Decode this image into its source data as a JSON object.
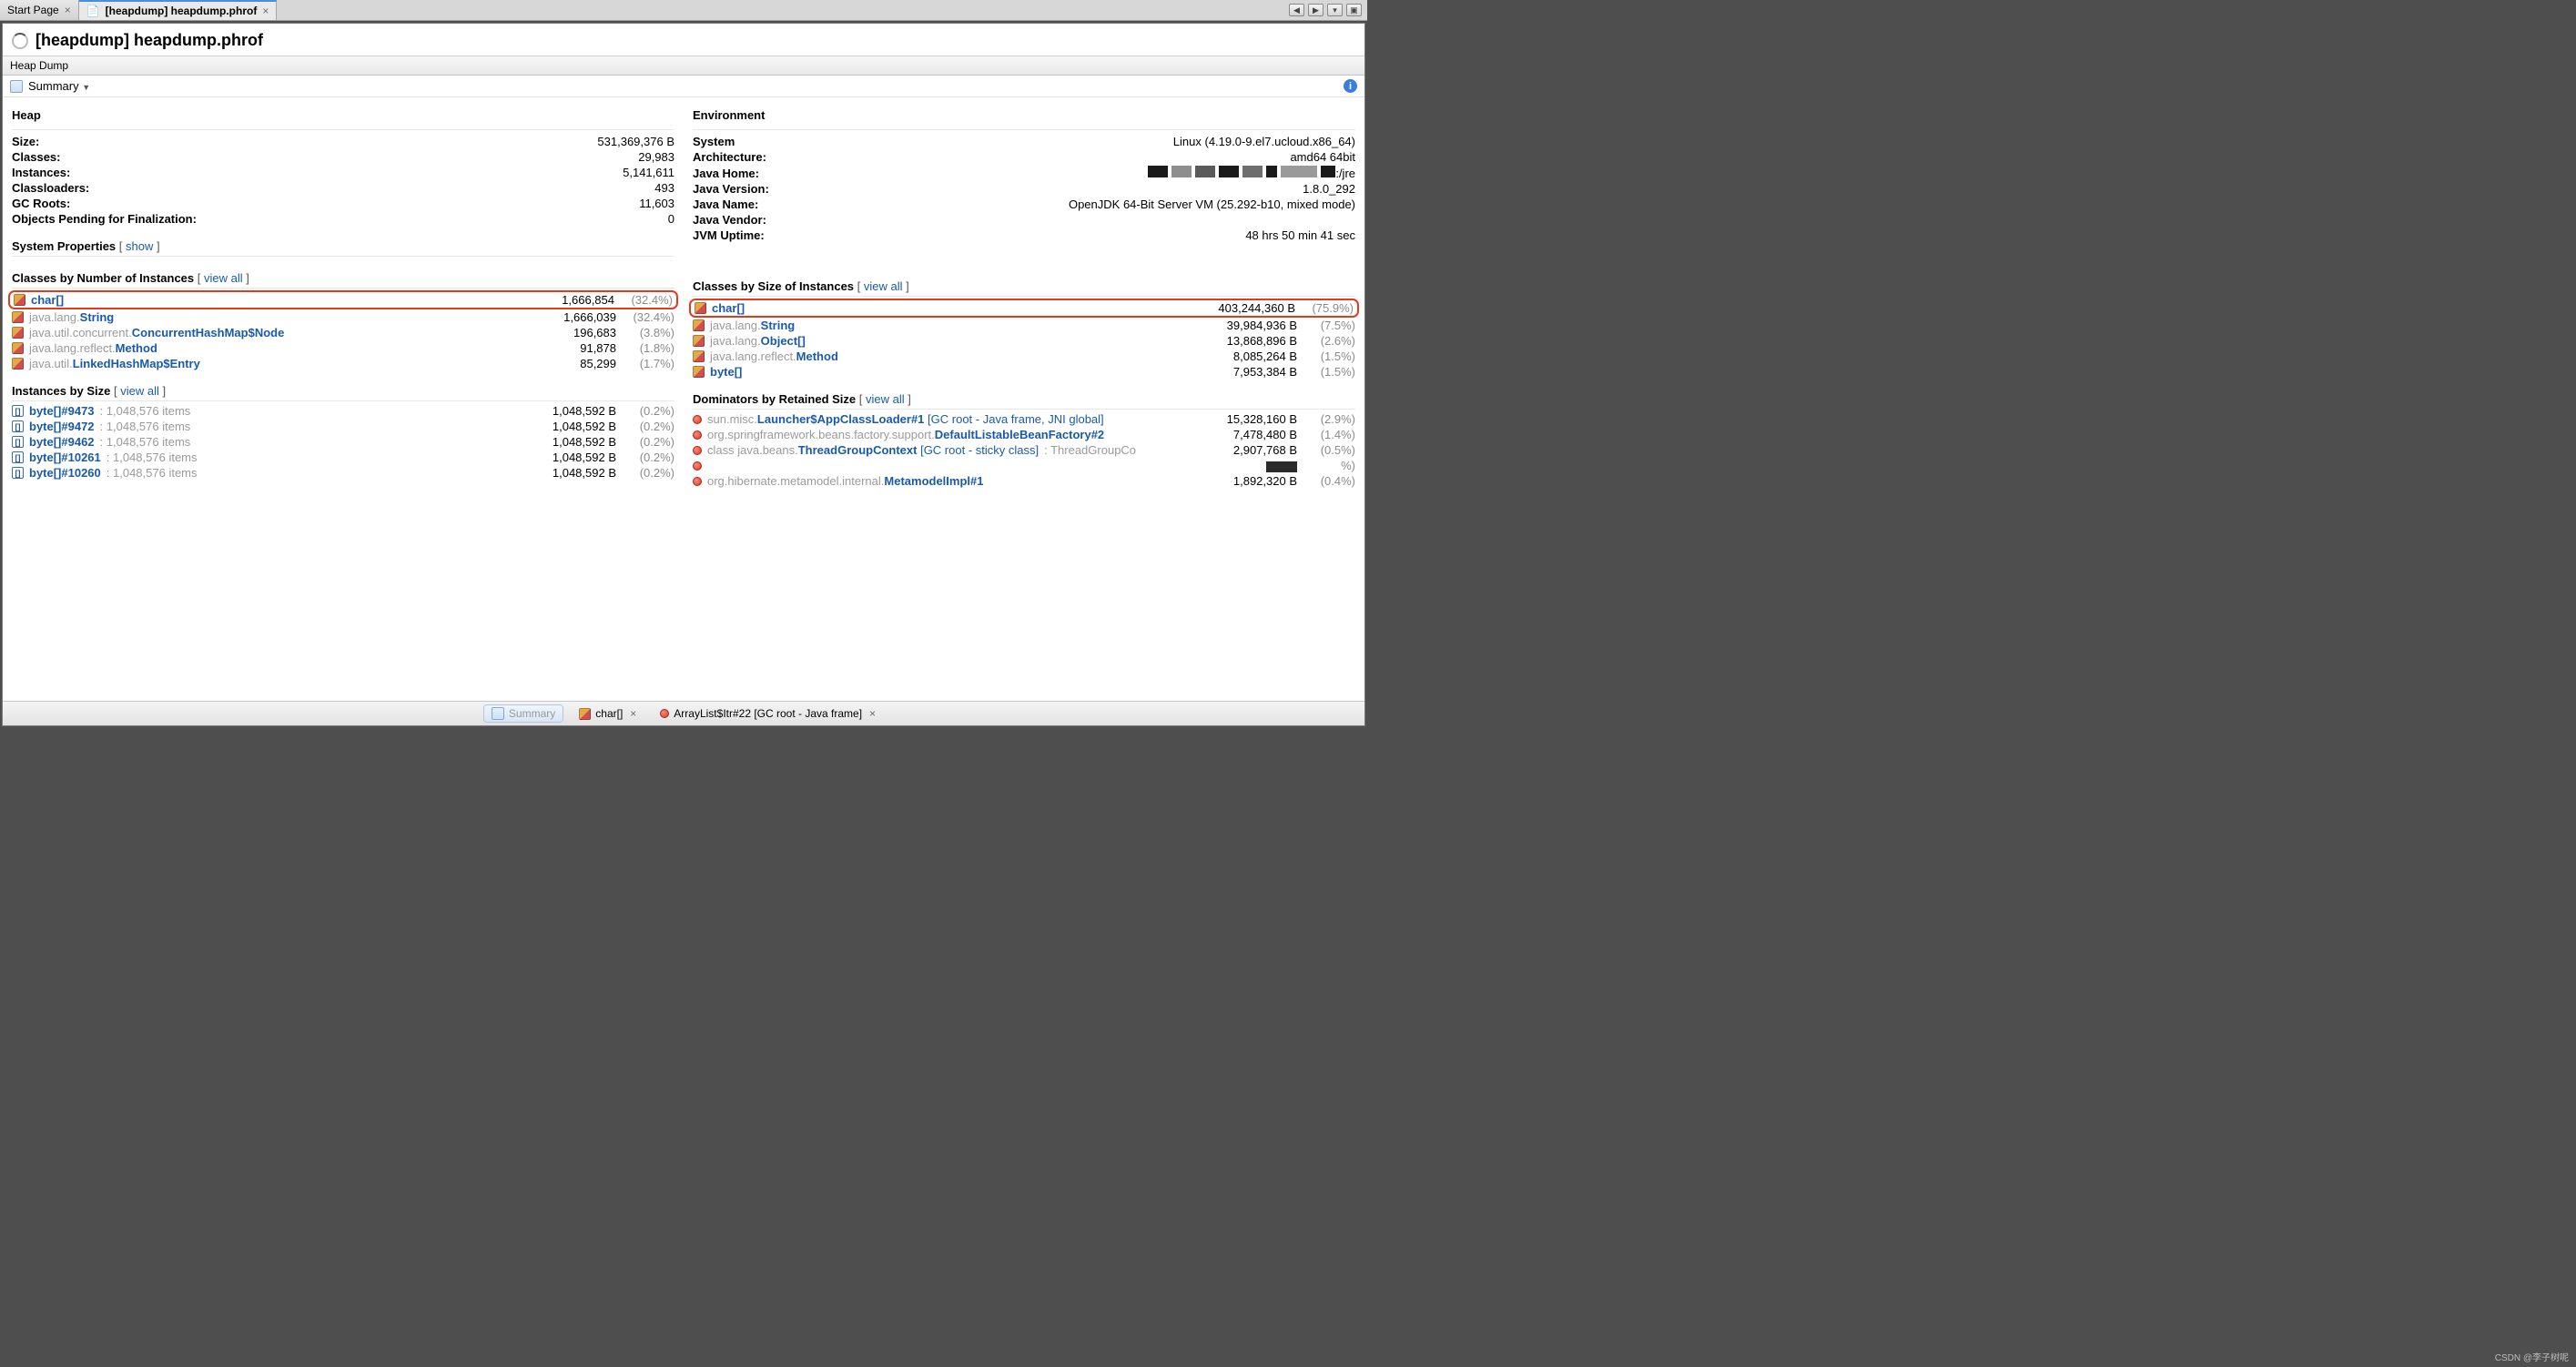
{
  "tabs": {
    "start": "Start Page",
    "heapdump": "[heapdump] heapdump.phrof"
  },
  "title": "[heapdump] heapdump.phrof",
  "subTab": "Heap Dump",
  "toolbar": {
    "summary": "Summary"
  },
  "heap": {
    "heading": "Heap",
    "rows": [
      {
        "label": "Size:",
        "value": "531,369,376 B"
      },
      {
        "label": "Classes:",
        "value": "29,983"
      },
      {
        "label": "Instances:",
        "value": "5,141,611"
      },
      {
        "label": "Classloaders:",
        "value": "493"
      },
      {
        "label": "GC Roots:",
        "value": "11,603"
      },
      {
        "label": "Objects Pending for Finalization:",
        "value": "0"
      }
    ]
  },
  "env": {
    "heading": "Environment",
    "rows": [
      {
        "label": "System",
        "value": "Linux (4.19.0-9.el7.ucloud.x86_64)"
      },
      {
        "label": "Architecture:",
        "value": "amd64 64bit"
      },
      {
        "label": "Java Home:",
        "value": ":/jre"
      },
      {
        "label": "Java Version:",
        "value": "1.8.0_292"
      },
      {
        "label": "Java Name:",
        "value": "OpenJDK 64-Bit Server VM (25.292-b10, mixed mode)"
      },
      {
        "label": "Java Vendor:",
        "value": ""
      },
      {
        "label": "JVM Uptime:",
        "value": "48 hrs 50 min 41 sec"
      }
    ]
  },
  "sysprops": {
    "heading": "System Properties",
    "linkText": "show"
  },
  "viewAll": "view all",
  "classesByNum": {
    "heading": "Classes by Number of Instances",
    "rows": [
      {
        "pkg": "",
        "name": "char[]",
        "num": "1,666,854",
        "pct": "(32.4%)",
        "hi": true
      },
      {
        "pkg": "java.lang.",
        "name": "String",
        "num": "1,666,039",
        "pct": "(32.4%)"
      },
      {
        "pkg": "java.util.concurrent.",
        "name": "ConcurrentHashMap$Node",
        "num": "196,683",
        "pct": "(3.8%)"
      },
      {
        "pkg": "java.lang.reflect.",
        "name": "Method",
        "num": "91,878",
        "pct": "(1.8%)"
      },
      {
        "pkg": "java.util.",
        "name": "LinkedHashMap$Entry",
        "num": "85,299",
        "pct": "(1.7%)"
      }
    ]
  },
  "classesBySize": {
    "heading": "Classes by Size of Instances",
    "rows": [
      {
        "pkg": "",
        "name": "char[]",
        "num": "403,244,360 B",
        "pct": "(75.9%)",
        "hi": true
      },
      {
        "pkg": "java.lang.",
        "name": "String",
        "num": "39,984,936 B",
        "pct": "(7.5%)"
      },
      {
        "pkg": "java.lang.",
        "name": "Object[]",
        "num": "13,868,896 B",
        "pct": "(2.6%)"
      },
      {
        "pkg": "java.lang.reflect.",
        "name": "Method",
        "num": "8,085,264 B",
        "pct": "(1.5%)"
      },
      {
        "pkg": "",
        "name": "byte[]",
        "num": "7,953,384 B",
        "pct": "(1.5%)"
      }
    ]
  },
  "instancesBySize": {
    "heading": "Instances by Size",
    "rows": [
      {
        "name": "byte[]#9473",
        "items": "1,048,576 items",
        "num": "1,048,592 B",
        "pct": "(0.2%)"
      },
      {
        "name": "byte[]#9472",
        "items": "1,048,576 items",
        "num": "1,048,592 B",
        "pct": "(0.2%)"
      },
      {
        "name": "byte[]#9462",
        "items": "1,048,576 items",
        "num": "1,048,592 B",
        "pct": "(0.2%)"
      },
      {
        "name": "byte[]#10261",
        "items": "1,048,576 items",
        "num": "1,048,592 B",
        "pct": "(0.2%)"
      },
      {
        "name": "byte[]#10260",
        "items": "1,048,576 items",
        "num": "1,048,592 B",
        "pct": "(0.2%)"
      }
    ]
  },
  "dominators": {
    "heading": "Dominators by Retained Size",
    "rows": [
      {
        "pkg": "sun.misc.",
        "name": "Launcher$AppClassLoader#1",
        "suffix": " [GC root - Java frame, JNI global]",
        "num": "15,328,160 B",
        "pct": "(2.9%)"
      },
      {
        "pkg": "org.springframework.beans.factory.support.",
        "name": "DefaultListableBeanFactory#2",
        "suffix": "",
        "num": "7,478,480 B",
        "pct": "(1.4%)"
      },
      {
        "pkg": "class java.beans.",
        "name": "ThreadGroupContext",
        "suffix": " [GC root - sticky class]",
        "extra": " : ThreadGroupCo",
        "num": "2,907,768 B",
        "pct": "(0.5%)"
      },
      {
        "pkg": "",
        "name": "",
        "suffix": "",
        "num": "",
        "pct": "%)",
        "redacted": true
      },
      {
        "pkg": "org.hibernate.metamodel.internal.",
        "name": "MetamodelImpl#1",
        "suffix": "",
        "num": "1,892,320 B",
        "pct": "(0.4%)"
      }
    ]
  },
  "bottomTabs": {
    "summary": "Summary",
    "char": "char[]",
    "arraylist": "ArrayList$Itr#22 [GC root - Java frame]"
  },
  "watermark": "CSDN @李子树呢"
}
